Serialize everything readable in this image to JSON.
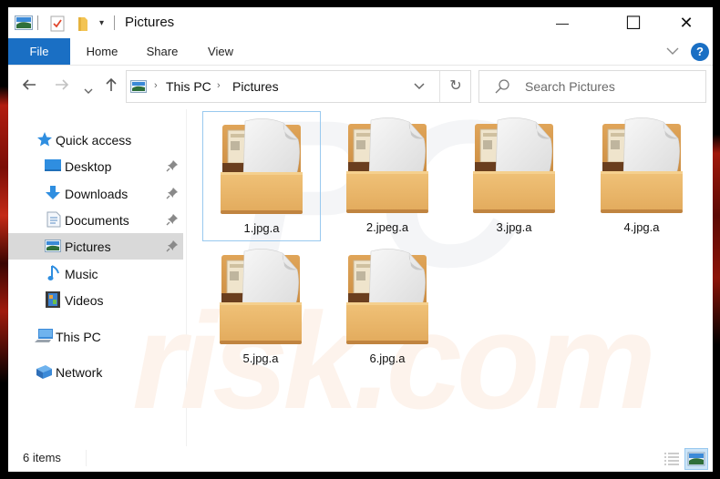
{
  "window": {
    "title": "Pictures",
    "controls": {
      "minimize": "—",
      "maximize": "☐",
      "close": "✕"
    }
  },
  "ribbon": {
    "tabs": [
      {
        "label": "File",
        "active": true
      },
      {
        "label": "Home"
      },
      {
        "label": "Share"
      },
      {
        "label": "View"
      }
    ],
    "expand_icon": "⌄",
    "help_label": "?"
  },
  "navigation": {
    "back": "←",
    "forward": "→",
    "recent": "⌄",
    "up": "↑",
    "breadcrumb": [
      "This PC",
      "Pictures"
    ],
    "breadcrumb_sep": "›",
    "dropdown": "⌄",
    "refresh": "↻",
    "search_placeholder": "Search Pictures"
  },
  "nav_pane": {
    "quick_access": {
      "label": "Quick access",
      "icon": "star-icon"
    },
    "quick_items": [
      {
        "label": "Desktop",
        "icon": "desktop-icon",
        "pinned": true
      },
      {
        "label": "Downloads",
        "icon": "download-icon",
        "pinned": true
      },
      {
        "label": "Documents",
        "icon": "documents-icon",
        "pinned": true
      },
      {
        "label": "Pictures",
        "icon": "pictures-icon",
        "pinned": true,
        "selected": true
      },
      {
        "label": "Music",
        "icon": "music-icon"
      },
      {
        "label": "Videos",
        "icon": "videos-icon"
      }
    ],
    "this_pc": {
      "label": "This PC",
      "icon": "computer-icon"
    },
    "network": {
      "label": "Network",
      "icon": "network-icon"
    }
  },
  "files": [
    {
      "name": "1.jpg.a",
      "icon": "archive-file-icon",
      "selected": true
    },
    {
      "name": "2.jpeg.a",
      "icon": "archive-file-icon"
    },
    {
      "name": "3.jpg.a",
      "icon": "archive-file-icon"
    },
    {
      "name": "4.jpg.a",
      "icon": "archive-file-icon"
    },
    {
      "name": "5.jpg.a",
      "icon": "archive-file-icon"
    },
    {
      "name": "6.jpg.a",
      "icon": "archive-file-icon"
    }
  ],
  "status": {
    "item_count": "6 items",
    "view_modes": [
      "details",
      "large-icons"
    ],
    "active_view": "large-icons"
  },
  "watermark": {
    "line1": "PC",
    "line2": "risk.com"
  },
  "colors": {
    "accent": "#1a6fc4",
    "selection_bg": "#d9d9d9",
    "selection_border": "#99c9ef",
    "folder": "#e8b466"
  }
}
